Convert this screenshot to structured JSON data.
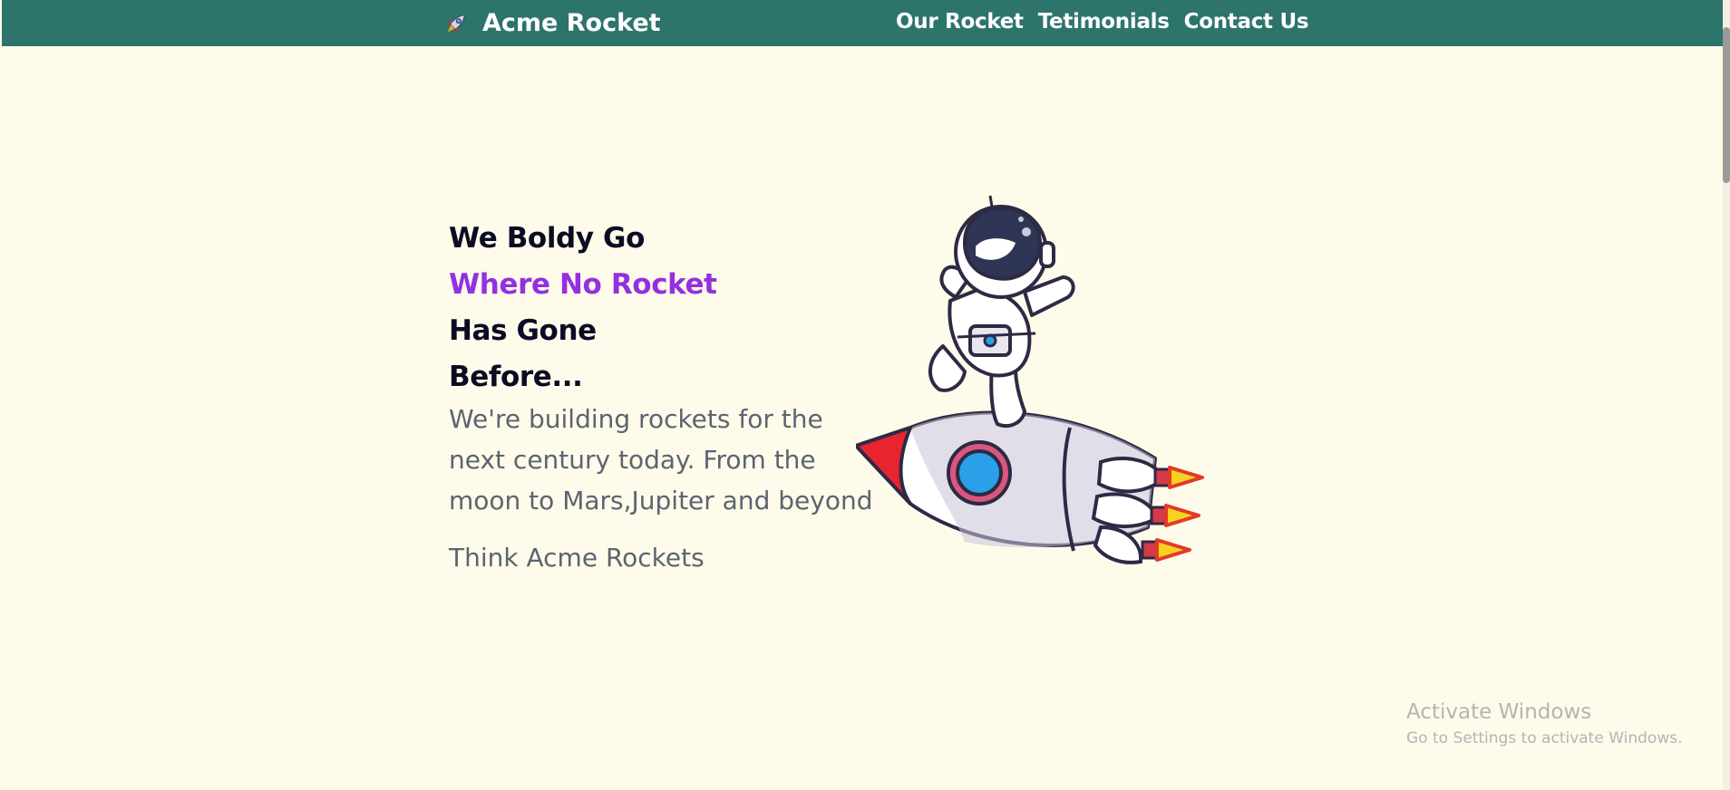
{
  "navbar": {
    "brand_label": "Acme Rocket",
    "brand_icon": "rocket-icon",
    "links": [
      {
        "label": "Our Rocket"
      },
      {
        "label": "Tetimonials"
      },
      {
        "label": "Contact Us"
      }
    ],
    "background_color": "#2d746b"
  },
  "hero": {
    "headline_lines": [
      "We Boldy Go",
      "Where No Rocket",
      "Has Gone",
      "Before..."
    ],
    "accent_color": "#9330e0",
    "lead": "We're building rockets for the next century today. From the moon to Mars,Jupiter and beyond",
    "tagline": "Think Acme Rockets",
    "illustration": "astronaut-on-rocket-illustration"
  },
  "watermark": {
    "title": "Activate Windows",
    "subtitle": "Go to Settings to activate Windows."
  },
  "page": {
    "background_color": "#fffbea"
  }
}
